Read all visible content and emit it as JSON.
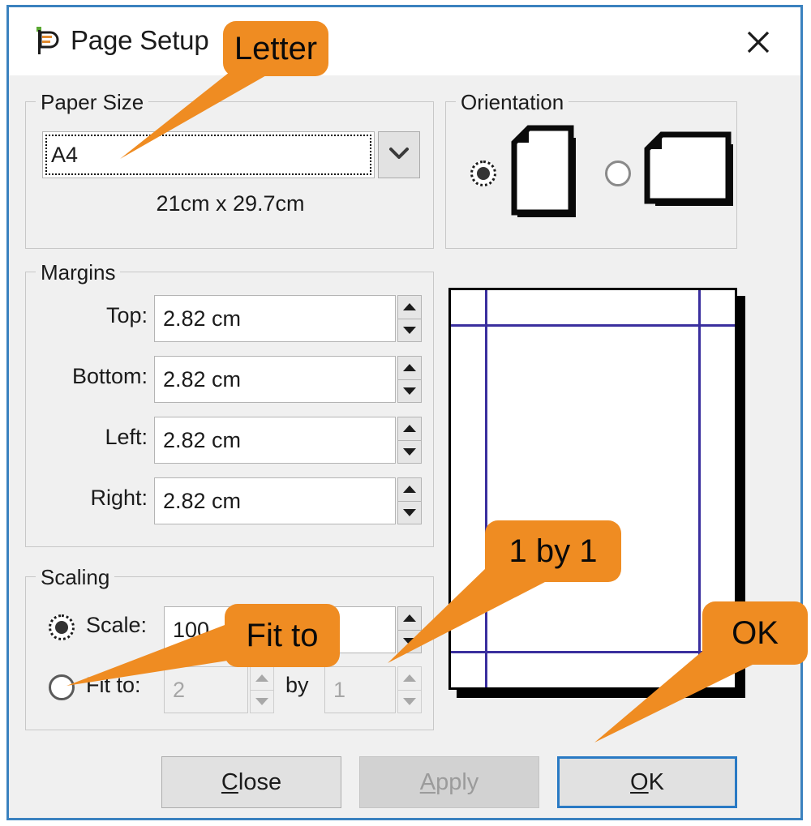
{
  "window": {
    "title": "Page Setup",
    "icon": "page-setup-icon",
    "close_label": "✕",
    "accent_border": "#3b82bf",
    "background": "#f0f0f0"
  },
  "paper_size": {
    "legend": "Paper Size",
    "value": "A4",
    "dropdown_icon": "chevron-down-icon",
    "dimensions_text": "21cm x 29.7cm"
  },
  "orientation": {
    "legend": "Orientation",
    "options": [
      {
        "name": "portrait",
        "selected": true
      },
      {
        "name": "landscape",
        "selected": false
      }
    ]
  },
  "margins": {
    "legend": "Margins",
    "fields": [
      {
        "label": "Top:",
        "value": "2.82 cm"
      },
      {
        "label": "Bottom:",
        "value": "2.82 cm"
      },
      {
        "label": "Left:",
        "value": "2.82 cm"
      },
      {
        "label": "Right:",
        "value": "2.82 cm"
      }
    ]
  },
  "scaling": {
    "legend": "Scaling",
    "scale": {
      "label": "Scale:",
      "value": "100",
      "selected": true
    },
    "fit_to": {
      "label": "Fit to:",
      "pages_wide": "2",
      "by_label": "by",
      "pages_tall": "1",
      "selected": false,
      "enabled": false
    }
  },
  "preview": {
    "name": "page-preview",
    "margin_guide_color": "#3a2f9e",
    "page_border_color": "#000000"
  },
  "buttons": [
    {
      "name": "close-button",
      "label": "Close",
      "accel": "C",
      "state": "enabled"
    },
    {
      "name": "apply-button",
      "label": "Apply",
      "accel": "A",
      "state": "disabled"
    },
    {
      "name": "ok-button",
      "label": "OK",
      "accel": "O",
      "state": "default"
    }
  ],
  "callouts": [
    {
      "name": "callout-letter",
      "text": "Letter"
    },
    {
      "name": "callout-fit-to",
      "text": "Fit to"
    },
    {
      "name": "callout-1-by-1",
      "text": "1 by 1"
    },
    {
      "name": "callout-ok",
      "text": "OK"
    }
  ],
  "colors": {
    "callout_orange": "#ef8c22",
    "focus_blue": "#2a7ac4",
    "dialog_border": "#3b82bf"
  }
}
